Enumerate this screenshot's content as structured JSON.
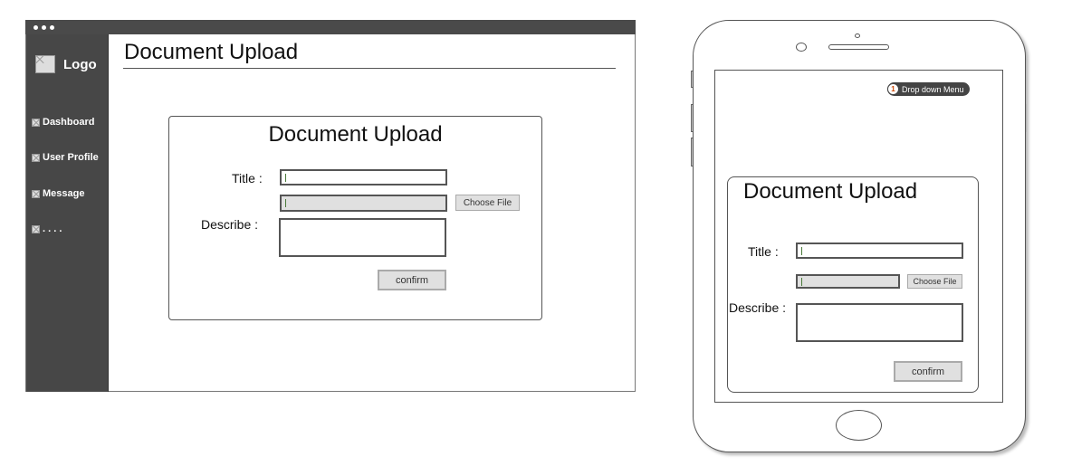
{
  "desktop": {
    "sidebar": {
      "logo": "Logo",
      "items": [
        {
          "label": "Dashboard"
        },
        {
          "label": "User Profile"
        },
        {
          "label": "Message"
        },
        {
          "label": ". . . ."
        }
      ]
    },
    "page_title": "Document Upload",
    "form": {
      "title": "Document Upload",
      "title_label": "Title :",
      "describe_label": "Describe :",
      "choose_file": "Choose File",
      "confirm": "confirm",
      "title_value": "",
      "file_value": "",
      "describe_value": ""
    }
  },
  "mobile": {
    "dropdown": {
      "badge": "1",
      "label": "Drop down Menu"
    },
    "form": {
      "title": "Document Upload",
      "title_label": "Title :",
      "describe_label": "Describe :",
      "choose_file": "Choose File",
      "confirm": "confirm",
      "title_value": "",
      "file_value": "",
      "describe_value": ""
    }
  }
}
